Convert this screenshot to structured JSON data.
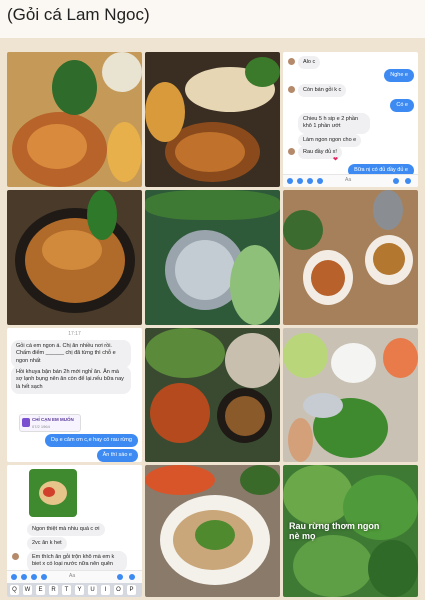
{
  "title": "(Gỏi cá Lam Ngoc)",
  "chat1": {
    "messages": [
      {
        "dir": "in",
        "text": "Alo c"
      },
      {
        "dir": "out",
        "text": "Nghe e"
      },
      {
        "dir": "in",
        "text": "Còn bán gỏi k c"
      },
      {
        "dir": "out",
        "text": "Có e"
      },
      {
        "dir": "in",
        "text": "Chieu 5 h sip e 2 phần khô 1 phần ướt"
      },
      {
        "dir": "in",
        "text": "Làm ngon ngon cho e"
      },
      {
        "dir": "in",
        "text": "Rau đầy đủ x!"
      },
      {
        "dir": "out",
        "text": "Bữa nị có đủ đầy đủ e"
      }
    ],
    "heart": "❤",
    "input_placeholder": "Aa"
  },
  "chat2": {
    "time": "17:17",
    "messages": [
      {
        "dir": "in",
        "text": "Gỏi cá em ngon á. Chị ăn nhiều nơi rồi. Chấm điểm ______ chị đã từng thì chỗ e ngon nhất"
      },
      {
        "dir": "in",
        "text": "Hồi khuya bận bán 2h mới nghỉ ăn. Ăn mà sợ lạnh bụng nên ăn còn để lại.nếu bữa nay là hết sạch"
      },
      {
        "dir": "out",
        "text": "Dạ e cảm ơn c,e hay có rau rừng"
      },
      {
        "dir": "out",
        "text": "Ăn thì sáo e"
      }
    ],
    "card_title": "CHỈ CẠN EM MUỐN",
    "card_sub": "07/2 1964"
  },
  "chat3": {
    "messages": [
      {
        "dir": "in",
        "text": "Ngon thiệt mà nhiu quá c ơi"
      },
      {
        "dir": "in",
        "text": "2vc ăn k het"
      },
      {
        "dir": "in",
        "text": "Em thích ăn gỏi trộn khô mà em k biet x có loại nước nữa nên quên"
      }
    ],
    "input_placeholder": "Aa",
    "keyboard_row": [
      "Q",
      "W",
      "E",
      "R",
      "T",
      "Y",
      "U",
      "I",
      "O",
      "P"
    ]
  },
  "photo_caption": "Rau rừng thơm ngon nè mọ",
  "colors": {
    "accent_blue": "#3d8bf2",
    "background": "#efe4d2"
  }
}
